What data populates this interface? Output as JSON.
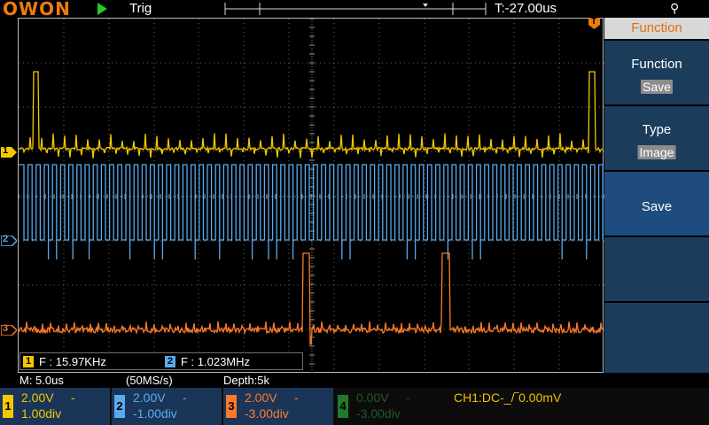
{
  "topbar": {
    "logo": "OWON",
    "trigger_status": "Trig",
    "trigger_time": "T:-27.00us",
    "usb_icon": "usb-icon"
  },
  "measurements": {
    "ch1_badge": "1",
    "ch1_freq": "F : 15.97KHz",
    "ch2_badge": "2",
    "ch2_freq": "F : 1.023MHz"
  },
  "menu": {
    "title": "Function",
    "items": [
      {
        "label": "Function",
        "value": "Save"
      },
      {
        "label": "Type",
        "value": "Image"
      },
      {
        "label": "Save",
        "value": ""
      },
      {
        "label": "",
        "value": ""
      },
      {
        "label": "",
        "value": ""
      }
    ]
  },
  "status": {
    "timebase": "M: 5.0us",
    "sample_rate": "(50MS/s)",
    "depth": "Depth:5k"
  },
  "channels": [
    {
      "num": "1",
      "volts": "2.00V",
      "coupling": "-",
      "offset": "1.00div",
      "color": "#f5c800"
    },
    {
      "num": "2",
      "volts": "2.00V",
      "coupling": "-",
      "offset": "-1.00div",
      "color": "#5aaaf0"
    },
    {
      "num": "3",
      "volts": "2.00V",
      "coupling": "-",
      "offset": "-3.00div",
      "color": "#ff7a28"
    },
    {
      "num": "4",
      "volts": "0.00V",
      "coupling": "-",
      "offset": "-3.00div",
      "color": "#1f7a2c"
    }
  ],
  "trigger_info": "CH1:DC-_/‾0.00mV",
  "markers": {
    "ch1": "1",
    "ch2": "2",
    "ch3": "3",
    "trig": "T"
  }
}
